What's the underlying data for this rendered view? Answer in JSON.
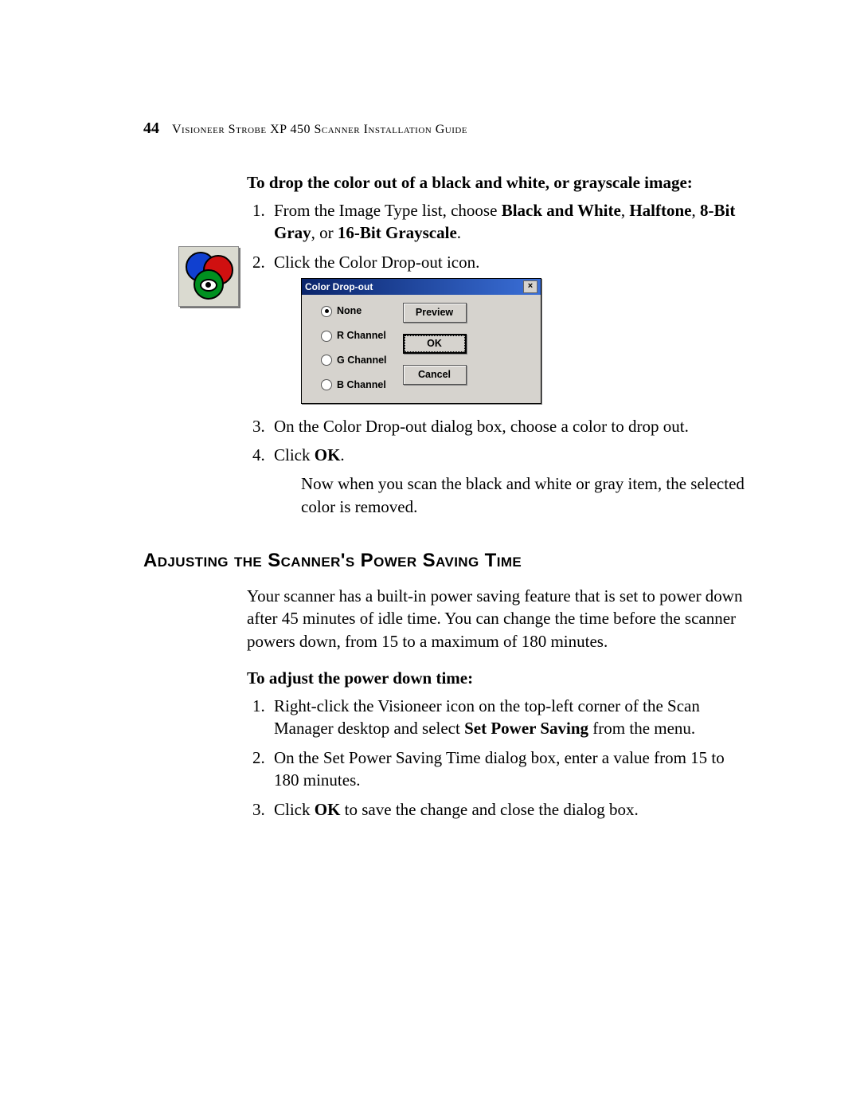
{
  "header": {
    "page_number": "44",
    "running_title": "Visioneer Strobe XP 450 Scanner Installation Guide"
  },
  "section1": {
    "intro": "To drop the color out of a black and white, or grayscale image:",
    "step1_pre": "From the Image Type list, choose ",
    "step1_b1": "Black and White",
    "step1_sep1": ", ",
    "step1_b2": "Halftone",
    "step1_sep2": ", ",
    "step1_b3": "8-Bit Gray",
    "step1_mid": ", or ",
    "step1_b4": "16-Bit Grayscale",
    "step1_end": ".",
    "step2": "Click the Color Drop-out icon.",
    "step3": "On the Color Drop-out dialog box, choose a color to drop out.",
    "step4_pre": "Click ",
    "step4_b": "OK",
    "step4_end": ".",
    "followup": "Now when you scan the black and white or gray item, the selected color is removed."
  },
  "dialog": {
    "title": "Color Drop-out",
    "close": "×",
    "radios": {
      "none": "None",
      "r": "R Channel",
      "g": "G Channel",
      "b": "B Channel"
    },
    "buttons": {
      "preview": "Preview",
      "ok": "OK",
      "cancel": "Cancel"
    }
  },
  "section2": {
    "heading": "Adjusting the Scanner's Power Saving Time",
    "para": "Your scanner has a built-in power saving feature that is set to power down after 45 minutes of idle time. You can change the time before the scanner powers down, from 15 to a maximum of 180 minutes.",
    "intro": "To adjust the power down time:",
    "step1_pre": "Right-click the Visioneer icon on the top-left corner of the Scan Manager desktop and select ",
    "step1_b": "Set Power Saving",
    "step1_end": " from the menu.",
    "step2": "On the Set Power Saving Time dialog box, enter a value from 15 to 180 minutes.",
    "step3_pre": "Click ",
    "step3_b": "OK",
    "step3_end": " to save the change and close the dialog box."
  }
}
